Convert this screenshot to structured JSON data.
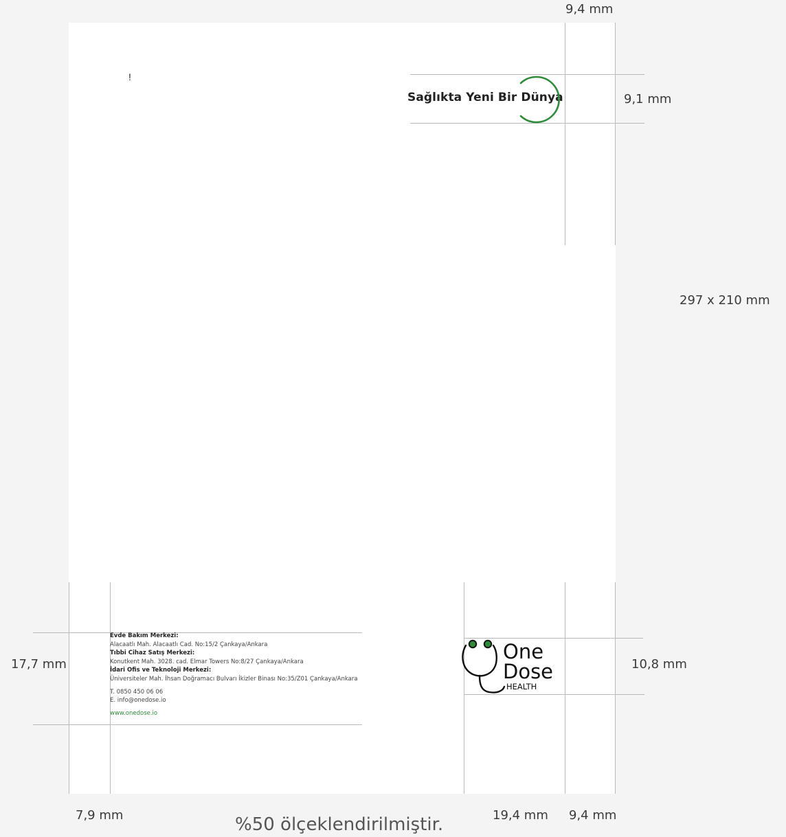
{
  "page": {
    "exclamation": "!",
    "slogan": "Sağlıkta Yeni Bir Dünya",
    "scale_note": "%50 ölçeklendirilmiştir."
  },
  "dimensions": {
    "top_right_margin": "9,4 mm",
    "slogan_height": "9,1 mm",
    "page_size": "297 x 210 mm",
    "footer_height": "17,7 mm",
    "logo_height": "10,8 mm",
    "left_margin": "7,9 mm",
    "logo_width": "19,4 mm",
    "bottom_right_margin": "9,4 mm"
  },
  "footer": {
    "centers": [
      {
        "title": "Evde Bakım Merkezi:",
        "address": "Alacaatlı Mah. Alacaatlı Cad. No:15/2 Çankaya/Ankara"
      },
      {
        "title": "Tıbbi Cihaz Satış Merkezi:",
        "address": "Konutkent Mah. 3028. cad. Elmar Towers No:8/27 Çankaya/Ankara"
      },
      {
        "title": "İdari Ofis ve Teknoloji Merkezi:",
        "address": "Üniversiteler Mah. İhsan Doğramacı Bulvarı İkizler Binası No:35/Z01 Çankaya/Ankara"
      }
    ],
    "phone": "T. 0850 450 06 06",
    "email": "E. info@onedose.io",
    "website": "www.onedose.io"
  },
  "logo": {
    "line1": "One",
    "line2": "Dose",
    "line3": "HEALTH"
  },
  "colors": {
    "brand_green": "#2e8b3a",
    "guide_line": "#b9b9b9",
    "background": "#f4f4f4"
  }
}
